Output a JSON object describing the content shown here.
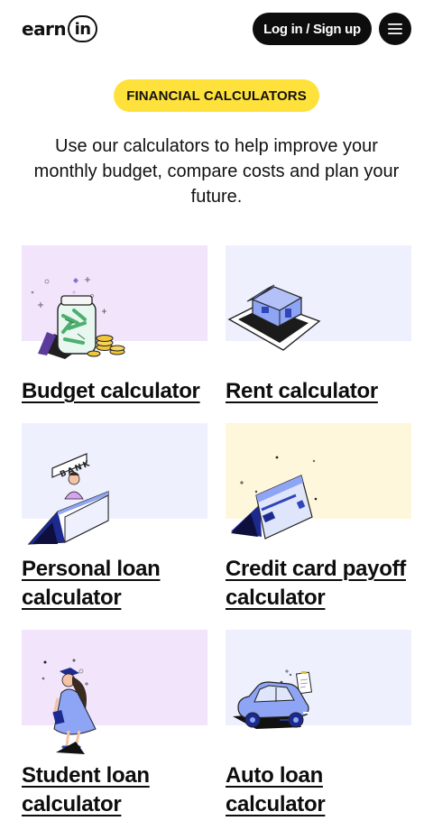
{
  "header": {
    "logo_text_left": "earn",
    "logo_text_right": "in",
    "login_label": "Log in / Sign up",
    "menu_icon": "hamburger-menu-icon"
  },
  "hero": {
    "badge": "FINANCIAL CALCULATORS",
    "intro": "Use our calculators to help improve your monthly budget, compare costs and plan your future."
  },
  "cards": [
    {
      "title": "Budget calculator",
      "image": "money-jar-illustration",
      "bg": "#f1e4fb"
    },
    {
      "title": "Rent calculator",
      "image": "house-illustration",
      "bg": "#eef1fd"
    },
    {
      "title": "Personal loan calculator",
      "image": "bank-teller-illustration",
      "bg": "#eef1fd"
    },
    {
      "title": "Credit card payoff calculator",
      "image": "credit-card-illustration",
      "bg": "#fff7dc"
    },
    {
      "title": "Student loan calculator",
      "image": "student-illustration",
      "bg": "#f1e4fb"
    },
    {
      "title": "Auto loan calculator",
      "image": "car-illustration",
      "bg": "#eef1fd"
    }
  ],
  "colors": {
    "accent_yellow": "#ffe13c",
    "dark": "#0d0d0d",
    "illustration_blue": "#8ea4f4",
    "illustration_navy": "#1c2a8f"
  }
}
